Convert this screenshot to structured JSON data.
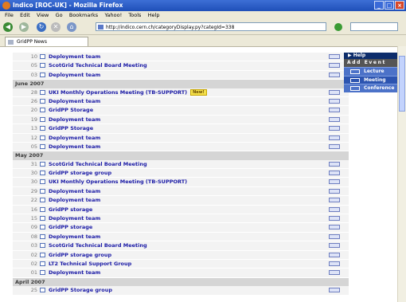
{
  "window": {
    "title": "Indico [ROC-UK] - Mozilla Firefox"
  },
  "menu": [
    "File",
    "Edit",
    "View",
    "Go",
    "Bookmarks",
    "Yahoo!",
    "Tools",
    "Help"
  ],
  "address": {
    "url": "http://indico.cern.ch/categoryDisplay.py?categId=338"
  },
  "tab": {
    "label": "GridPP News"
  },
  "sidebar": {
    "help": "Help",
    "add_event": "Add Event",
    "items": [
      "Lecture",
      "Meeting",
      "Conference"
    ]
  },
  "events": [
    {
      "day": "10",
      "title": "Deployment team"
    },
    {
      "day": "05",
      "title": "ScotGrid Technical Board Meeting"
    },
    {
      "day": "03",
      "title": "Deployment team"
    },
    {
      "month": "June 2007"
    },
    {
      "day": "28",
      "title": "UKI Monthly Operations Meeting (TB-SUPPORT)",
      "badge": "New!"
    },
    {
      "day": "26",
      "title": "Deployment team"
    },
    {
      "day": "20",
      "title": "GridPP Storage"
    },
    {
      "day": "19",
      "title": "Deployment team"
    },
    {
      "day": "13",
      "title": "GridPP Storage"
    },
    {
      "day": "12",
      "title": "Deployment team"
    },
    {
      "day": "05",
      "title": "Deployment team"
    },
    {
      "month": "May 2007"
    },
    {
      "day": "31",
      "title": "ScotGrid Technical Board Meeting"
    },
    {
      "day": "30",
      "title": "GridPP storage group"
    },
    {
      "day": "30",
      "title": "UKI Monthly Operations Meeting (TB-SUPPORT)"
    },
    {
      "day": "29",
      "title": "Deployment team"
    },
    {
      "day": "22",
      "title": "Deployment team"
    },
    {
      "day": "16",
      "title": "GridPP storage"
    },
    {
      "day": "15",
      "title": "Deployment team"
    },
    {
      "day": "09",
      "title": "GridPP storage"
    },
    {
      "day": "08",
      "title": "Deployment team"
    },
    {
      "day": "03",
      "title": "ScotGrid Technical Board Meeting"
    },
    {
      "day": "02",
      "title": "GridPP storage group"
    },
    {
      "day": "02",
      "title": "LT2 Technical Support Group"
    },
    {
      "day": "01",
      "title": "Deployment team"
    },
    {
      "month": "April 2007"
    },
    {
      "day": "25",
      "title": "GridPP Storage group"
    }
  ]
}
